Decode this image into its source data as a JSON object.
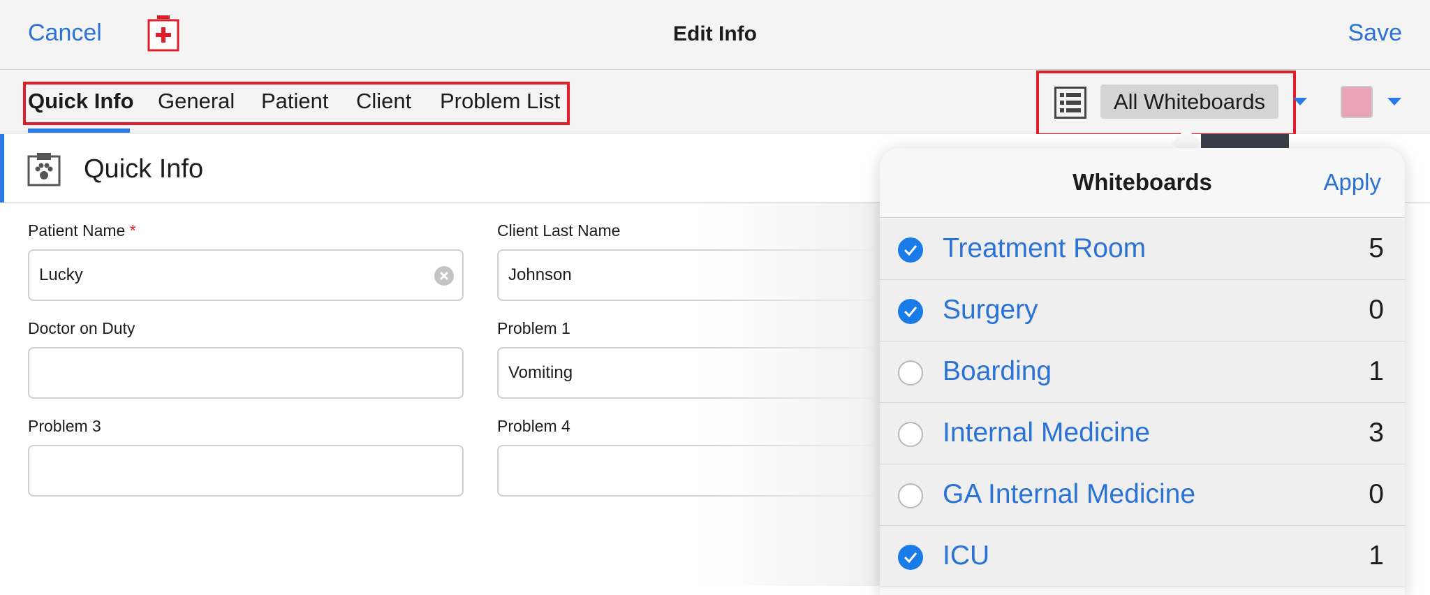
{
  "navbar": {
    "cancel": "Cancel",
    "title": "Edit Info",
    "save": "Save",
    "logo_icon": "medical-kit-icon"
  },
  "tabs": [
    {
      "label": "Quick Info",
      "active": true
    },
    {
      "label": "General",
      "active": false
    },
    {
      "label": "Patient",
      "active": false
    },
    {
      "label": "Client",
      "active": false
    },
    {
      "label": "Problem List",
      "active": false
    }
  ],
  "toolbar": {
    "whiteboard_selector": "All Whiteboards",
    "list_icon": "list-icon",
    "color_swatch": "#e8a4b4"
  },
  "section": {
    "title": "Quick Info",
    "icon": "clipboard-paw-icon"
  },
  "form": {
    "patient_name_label": "Patient Name",
    "patient_name_required": "*",
    "patient_name_value": "Lucky",
    "client_last_name_label": "Client Last Name",
    "client_last_name_value": "Johnson",
    "doctor_label": "Doctor on Duty",
    "doctor_value": "",
    "problem1_label": "Problem 1",
    "problem1_value": "Vomiting",
    "problem3_label": "Problem 3",
    "problem3_value": "",
    "problem4_label": "Problem 4",
    "problem4_value": ""
  },
  "popover": {
    "title": "Whiteboards",
    "apply": "Apply",
    "items": [
      {
        "label": "Treatment Room",
        "count": "5",
        "checked": true
      },
      {
        "label": "Surgery",
        "count": "0",
        "checked": true
      },
      {
        "label": "Boarding",
        "count": "1",
        "checked": false
      },
      {
        "label": "Internal Medicine",
        "count": "3",
        "checked": false
      },
      {
        "label": "GA Internal Medicine",
        "count": "0",
        "checked": false
      },
      {
        "label": "ICU",
        "count": "1",
        "checked": true
      }
    ]
  },
  "colors": {
    "accent": "#2a7ae6",
    "link": "#2a72d6",
    "highlight_box": "#e01e2b"
  }
}
